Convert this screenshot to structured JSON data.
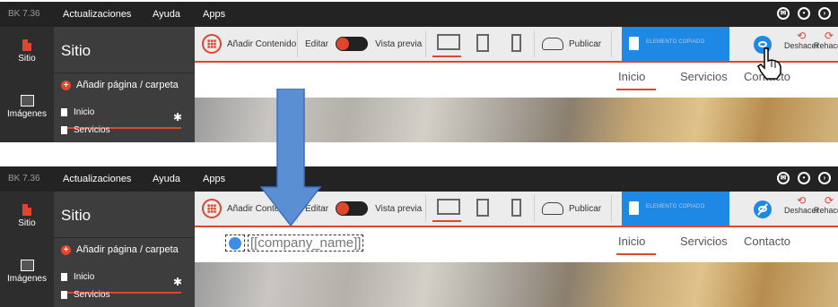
{
  "app": {
    "version": "BK 7.36",
    "menu": [
      "Actualizaciones",
      "Ayuda",
      "Apps"
    ]
  },
  "rail": {
    "site_label": "Sitio",
    "images_label": "Imágenes"
  },
  "sidebar": {
    "title": "Sitio",
    "add_label": "Añadir página / carpeta",
    "items": [
      "Inicio",
      "Servicios"
    ]
  },
  "toolbar": {
    "add_content": "Añadir Contenido",
    "edit": "Editar",
    "preview": "Vista previa",
    "publish": "Publicar",
    "copied": "ELEMENTO COPIADO",
    "undo": "Deshacer",
    "redo": "Rehacer"
  },
  "site": {
    "nav": [
      "Inicio",
      "Servicios",
      "Contacto"
    ],
    "logo_placeholder": "[[company_name]]"
  },
  "colors": {
    "accent": "#e0452e",
    "blue": "#1e88e5",
    "dark_bar": "#232323"
  },
  "icons": [
    "message-icon",
    "user-icon",
    "logout-icon",
    "grid-icon",
    "monitor-icon",
    "tablet-icon",
    "phone-icon",
    "cloud-icon",
    "clipboard-icon",
    "eye-icon",
    "undo-icon",
    "redo-icon",
    "hand-cursor-icon",
    "gear-icon"
  ]
}
